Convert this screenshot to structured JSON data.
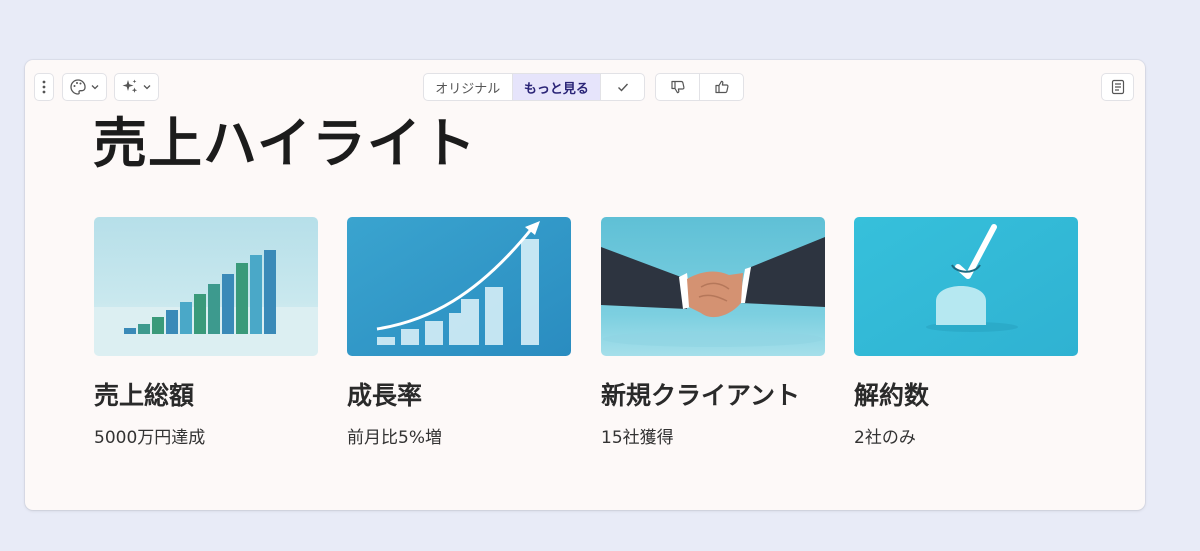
{
  "toolbar": {
    "segment": {
      "original_label": "オリジナル",
      "more_label": "もっと見る",
      "confirm_icon": "check-icon"
    },
    "icons": {
      "menu": "vertical-dots-icon",
      "palette": "palette-icon",
      "sparkle": "sparkle-icon",
      "thumbs_down": "thumbs-down-icon",
      "thumbs_up": "thumbs-up-icon",
      "notes": "notes-icon"
    },
    "accent_color": "#e6e4fb"
  },
  "slide": {
    "title": "売上ハイライト",
    "items": [
      {
        "title": "売上総額",
        "description": "5000万円達成",
        "image": "bar-chart-illustration"
      },
      {
        "title": "成長率",
        "description": "前月比5%増",
        "image": "growth-arrow-illustration"
      },
      {
        "title": "新規クライアント",
        "description": "15社獲得",
        "image": "handshake-photo"
      },
      {
        "title": "解約数",
        "description": "2社のみ",
        "image": "checkmark-illustration"
      }
    ]
  }
}
